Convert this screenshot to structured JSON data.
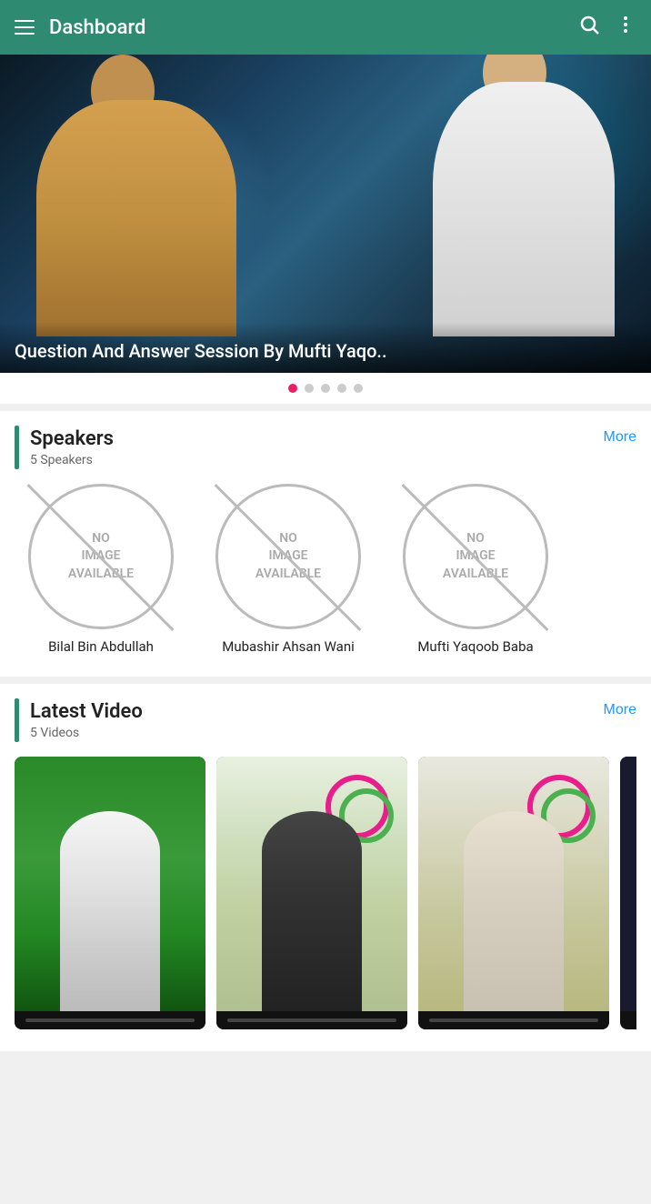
{
  "header": {
    "title": "Dashboard",
    "menu_icon": "☰",
    "search_icon": "🔍",
    "more_icon": "⋮"
  },
  "carousel": {
    "title": "Question And Answer Session By Mufti Yaqo..",
    "dots": [
      {
        "active": true
      },
      {
        "active": false
      },
      {
        "active": false
      },
      {
        "active": false
      },
      {
        "active": false
      }
    ]
  },
  "speakers": {
    "section_title": "Speakers",
    "section_count": "5 Speakers",
    "more_label": "More",
    "items": [
      {
        "name": "Bilal Bin Abdullah",
        "image_text_line1": "No",
        "image_text_line2": "Image",
        "image_text_line3": "Available"
      },
      {
        "name": "Mubashir Ahsan Wani",
        "image_text_line1": "No",
        "image_text_line2": "Image",
        "image_text_line3": "Available"
      },
      {
        "name": "Mufti Yaqoob Baba",
        "image_text_line1": "No",
        "image_text_line2": "Image",
        "image_text_line3": "Available"
      }
    ]
  },
  "latest_video": {
    "section_title": "Latest Video",
    "section_count": "5 Videos",
    "more_label": "More"
  },
  "colors": {
    "primary": "#2e8b72",
    "accent": "#2196f3",
    "dot_active": "#e91e63",
    "dot_inactive": "#cccccc"
  }
}
